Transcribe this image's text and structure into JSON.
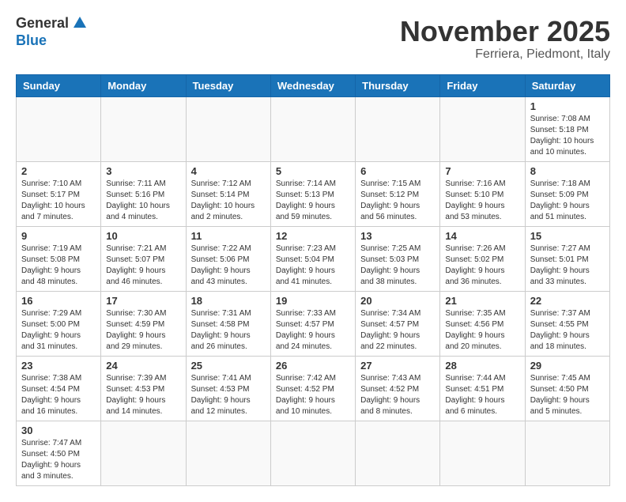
{
  "header": {
    "logo_general": "General",
    "logo_blue": "Blue",
    "month_title": "November 2025",
    "location": "Ferriera, Piedmont, Italy"
  },
  "weekdays": [
    "Sunday",
    "Monday",
    "Tuesday",
    "Wednesday",
    "Thursday",
    "Friday",
    "Saturday"
  ],
  "weeks": [
    [
      {
        "day": "",
        "info": ""
      },
      {
        "day": "",
        "info": ""
      },
      {
        "day": "",
        "info": ""
      },
      {
        "day": "",
        "info": ""
      },
      {
        "day": "",
        "info": ""
      },
      {
        "day": "",
        "info": ""
      },
      {
        "day": "1",
        "info": "Sunrise: 7:08 AM\nSunset: 5:18 PM\nDaylight: 10 hours\nand 10 minutes."
      }
    ],
    [
      {
        "day": "2",
        "info": "Sunrise: 7:10 AM\nSunset: 5:17 PM\nDaylight: 10 hours\nand 7 minutes."
      },
      {
        "day": "3",
        "info": "Sunrise: 7:11 AM\nSunset: 5:16 PM\nDaylight: 10 hours\nand 4 minutes."
      },
      {
        "day": "4",
        "info": "Sunrise: 7:12 AM\nSunset: 5:14 PM\nDaylight: 10 hours\nand 2 minutes."
      },
      {
        "day": "5",
        "info": "Sunrise: 7:14 AM\nSunset: 5:13 PM\nDaylight: 9 hours\nand 59 minutes."
      },
      {
        "day": "6",
        "info": "Sunrise: 7:15 AM\nSunset: 5:12 PM\nDaylight: 9 hours\nand 56 minutes."
      },
      {
        "day": "7",
        "info": "Sunrise: 7:16 AM\nSunset: 5:10 PM\nDaylight: 9 hours\nand 53 minutes."
      },
      {
        "day": "8",
        "info": "Sunrise: 7:18 AM\nSunset: 5:09 PM\nDaylight: 9 hours\nand 51 minutes."
      }
    ],
    [
      {
        "day": "9",
        "info": "Sunrise: 7:19 AM\nSunset: 5:08 PM\nDaylight: 9 hours\nand 48 minutes."
      },
      {
        "day": "10",
        "info": "Sunrise: 7:21 AM\nSunset: 5:07 PM\nDaylight: 9 hours\nand 46 minutes."
      },
      {
        "day": "11",
        "info": "Sunrise: 7:22 AM\nSunset: 5:06 PM\nDaylight: 9 hours\nand 43 minutes."
      },
      {
        "day": "12",
        "info": "Sunrise: 7:23 AM\nSunset: 5:04 PM\nDaylight: 9 hours\nand 41 minutes."
      },
      {
        "day": "13",
        "info": "Sunrise: 7:25 AM\nSunset: 5:03 PM\nDaylight: 9 hours\nand 38 minutes."
      },
      {
        "day": "14",
        "info": "Sunrise: 7:26 AM\nSunset: 5:02 PM\nDaylight: 9 hours\nand 36 minutes."
      },
      {
        "day": "15",
        "info": "Sunrise: 7:27 AM\nSunset: 5:01 PM\nDaylight: 9 hours\nand 33 minutes."
      }
    ],
    [
      {
        "day": "16",
        "info": "Sunrise: 7:29 AM\nSunset: 5:00 PM\nDaylight: 9 hours\nand 31 minutes."
      },
      {
        "day": "17",
        "info": "Sunrise: 7:30 AM\nSunset: 4:59 PM\nDaylight: 9 hours\nand 29 minutes."
      },
      {
        "day": "18",
        "info": "Sunrise: 7:31 AM\nSunset: 4:58 PM\nDaylight: 9 hours\nand 26 minutes."
      },
      {
        "day": "19",
        "info": "Sunrise: 7:33 AM\nSunset: 4:57 PM\nDaylight: 9 hours\nand 24 minutes."
      },
      {
        "day": "20",
        "info": "Sunrise: 7:34 AM\nSunset: 4:57 PM\nDaylight: 9 hours\nand 22 minutes."
      },
      {
        "day": "21",
        "info": "Sunrise: 7:35 AM\nSunset: 4:56 PM\nDaylight: 9 hours\nand 20 minutes."
      },
      {
        "day": "22",
        "info": "Sunrise: 7:37 AM\nSunset: 4:55 PM\nDaylight: 9 hours\nand 18 minutes."
      }
    ],
    [
      {
        "day": "23",
        "info": "Sunrise: 7:38 AM\nSunset: 4:54 PM\nDaylight: 9 hours\nand 16 minutes."
      },
      {
        "day": "24",
        "info": "Sunrise: 7:39 AM\nSunset: 4:53 PM\nDaylight: 9 hours\nand 14 minutes."
      },
      {
        "day": "25",
        "info": "Sunrise: 7:41 AM\nSunset: 4:53 PM\nDaylight: 9 hours\nand 12 minutes."
      },
      {
        "day": "26",
        "info": "Sunrise: 7:42 AM\nSunset: 4:52 PM\nDaylight: 9 hours\nand 10 minutes."
      },
      {
        "day": "27",
        "info": "Sunrise: 7:43 AM\nSunset: 4:52 PM\nDaylight: 9 hours\nand 8 minutes."
      },
      {
        "day": "28",
        "info": "Sunrise: 7:44 AM\nSunset: 4:51 PM\nDaylight: 9 hours\nand 6 minutes."
      },
      {
        "day": "29",
        "info": "Sunrise: 7:45 AM\nSunset: 4:50 PM\nDaylight: 9 hours\nand 5 minutes."
      }
    ],
    [
      {
        "day": "30",
        "info": "Sunrise: 7:47 AM\nSunset: 4:50 PM\nDaylight: 9 hours\nand 3 minutes."
      },
      {
        "day": "",
        "info": ""
      },
      {
        "day": "",
        "info": ""
      },
      {
        "day": "",
        "info": ""
      },
      {
        "day": "",
        "info": ""
      },
      {
        "day": "",
        "info": ""
      },
      {
        "day": "",
        "info": ""
      }
    ]
  ]
}
